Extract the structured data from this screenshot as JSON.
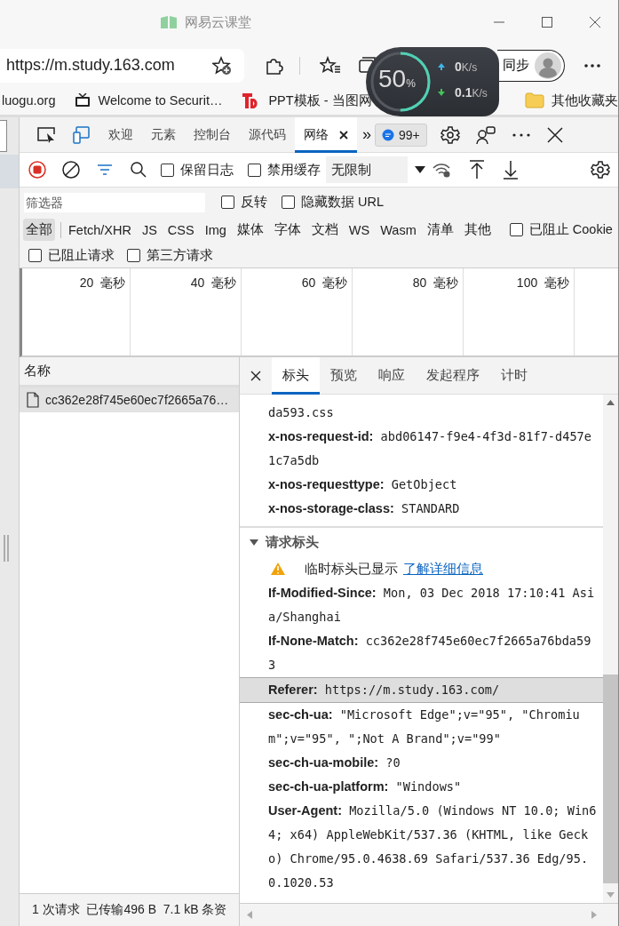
{
  "window": {
    "title": "网易云课堂"
  },
  "address_bar": {
    "url": "https://m.study.163.com"
  },
  "profile": {
    "label": "同步"
  },
  "speed_widget": {
    "percent": "50",
    "percent_unit": "%",
    "upload": "0",
    "upload_unit": "K/s",
    "download": "0.1",
    "download_unit": "K/s",
    "level": 0.5
  },
  "bookmarks": [
    {
      "label": "luogu.org",
      "kind": "plain"
    },
    {
      "label": "Welcome to Securit…",
      "kind": "tv"
    },
    {
      "label": "PPT模板 - 当图网",
      "kind": "brand"
    }
  ],
  "other_bookmarks": "其他收藏夹",
  "devtools": {
    "tabs": [
      {
        "label": "欢迎",
        "selected": false
      },
      {
        "label": "元素",
        "selected": false
      },
      {
        "label": "控制台",
        "selected": false
      },
      {
        "label": "源代码",
        "selected": false
      },
      {
        "label": "网络",
        "selected": true
      }
    ],
    "more": "»",
    "issues_badge": "99+"
  },
  "toolbar": {
    "recording": true,
    "preserve_log": {
      "label": "保留日志",
      "checked": false
    },
    "disable_cache": {
      "label": "禁用缓存",
      "checked": false
    },
    "throttling": "无限制"
  },
  "filter": {
    "placeholder": "筛选器",
    "invert": {
      "label": "反转",
      "checked": false
    },
    "hide_data_urls": {
      "label": "隐藏数据 URL",
      "checked": false
    }
  },
  "type_filters": [
    {
      "label": "全部",
      "selected": true
    },
    {
      "label": "Fetch/XHR",
      "selected": false
    },
    {
      "label": "JS",
      "selected": false
    },
    {
      "label": "CSS",
      "selected": false
    },
    {
      "label": "Img",
      "selected": false
    },
    {
      "label": "媒体",
      "selected": false
    },
    {
      "label": "字体",
      "selected": false
    },
    {
      "label": "文档",
      "selected": false
    },
    {
      "label": "WS",
      "selected": false
    },
    {
      "label": "Wasm",
      "selected": false
    },
    {
      "label": "清单",
      "selected": false
    },
    {
      "label": "其他",
      "selected": false
    }
  ],
  "blocked_cookies": {
    "label": "已阻止 Cookie",
    "checked": false
  },
  "blocked_requests": {
    "label": "已阻止请求",
    "checked": false
  },
  "third_party": {
    "label": "第三方请求",
    "checked": false
  },
  "overview": {
    "ticks": [
      "20  毫秒",
      "40  毫秒",
      "60  毫秒",
      "80  毫秒",
      "100  毫秒"
    ]
  },
  "requests": {
    "column": "名称",
    "rows": [
      {
        "name": "cc362e28f745e60ec7f2665a76…",
        "selected": true
      }
    ]
  },
  "status_bar": "1 次请求  已传输496 B  7.1 kB 条资",
  "detail_tabs": [
    {
      "label": "标头",
      "selected": true
    },
    {
      "label": "预览",
      "selected": false
    },
    {
      "label": "响应",
      "selected": false
    },
    {
      "label": "发起程序",
      "selected": false
    },
    {
      "label": "计时",
      "selected": false
    }
  ],
  "response_headers": [
    {
      "kind": "continuation",
      "value": "da593.css",
      "highlighted": false
    },
    {
      "kind": "header",
      "name": "x-nos-request-id:",
      "value": "abd06147-f9e4-4f3d-81f7-d457e1c7a5db",
      "highlighted": false
    },
    {
      "kind": "header",
      "name": "x-nos-requesttype:",
      "value": "GetObject",
      "highlighted": false
    },
    {
      "kind": "header",
      "name": "x-nos-storage-class:",
      "value": "STANDARD",
      "highlighted": false
    }
  ],
  "request_section": {
    "title": "请求标头",
    "expanded": true,
    "warning": "临时标头已显示",
    "link": "了解详细信息"
  },
  "request_headers": [
    {
      "kind": "header",
      "name": "If-Modified-Since:",
      "value": "Mon, 03 Dec 2018 17:10:41 Asia/Shanghai",
      "highlighted": false
    },
    {
      "kind": "header",
      "name": "If-None-Match:",
      "value": "cc362e28f745e60ec7f2665a76bda593",
      "highlighted": false
    },
    {
      "kind": "header",
      "name": "Referer:",
      "value": "https://m.study.163.com/",
      "highlighted": true
    },
    {
      "kind": "header",
      "name": "sec-ch-ua:",
      "value": "\"Microsoft Edge\";v=\"95\", \"Chromium\";v=\"95\", \";Not A Brand\";v=\"99\"",
      "highlighted": false
    },
    {
      "kind": "header",
      "name": "sec-ch-ua-mobile:",
      "value": "?0",
      "highlighted": false
    },
    {
      "kind": "header",
      "name": "sec-ch-ua-platform:",
      "value": "\"Windows\"",
      "highlighted": false
    },
    {
      "kind": "header",
      "name": "User-Agent:",
      "value": "Mozilla/5.0 (Windows NT 10.0; Win64; x64) AppleWebKit/537.36 (KHTML, like Gecko) Chrome/95.0.4638.69 Safari/537.36 Edg/95.0.1020.53",
      "highlighted": false
    }
  ]
}
